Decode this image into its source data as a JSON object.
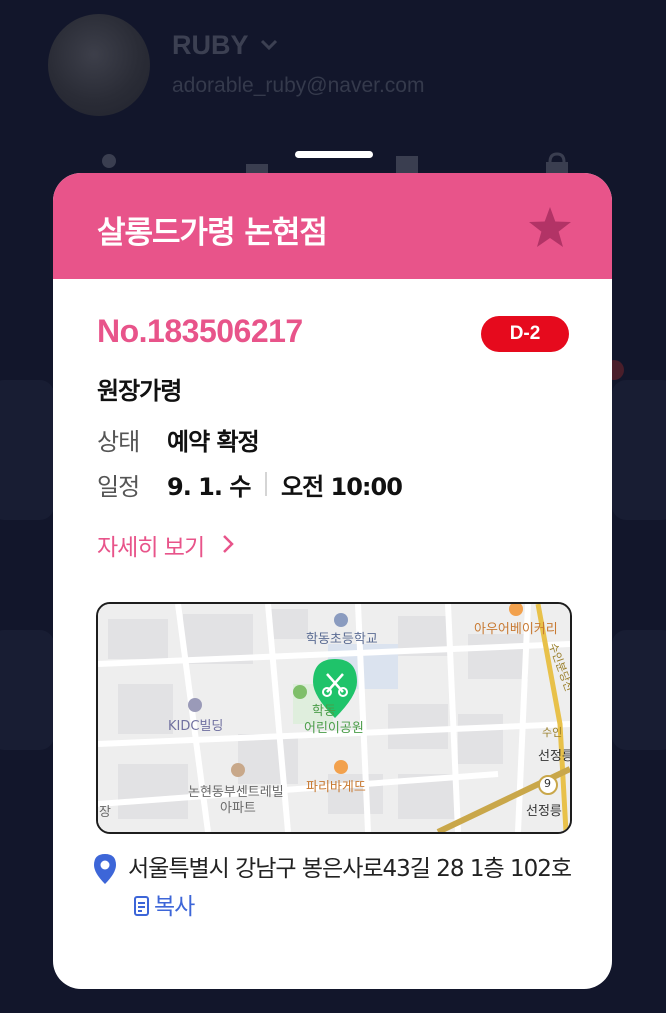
{
  "profile": {
    "name": "RUBY",
    "email": "adorable_ruby@naver.com"
  },
  "reservation": {
    "shop_name": "살롱드가령 논현점",
    "number": "No.183506217",
    "dday": "D-2",
    "service": "원장가령",
    "status_label": "상태",
    "status_value": "예약 확정",
    "schedule_label": "일정",
    "date": "9. 1. 수",
    "time": "오전 10:00",
    "detail_link": "자세히 보기"
  },
  "map": {
    "labels": {
      "school": "학동초등학교",
      "bakery_top": "아우어베이커리",
      "station_line": "수인분당선",
      "park_line1": "학동",
      "park_line2": "어린이공원",
      "kidc": "KIDC빌딩",
      "paris": "파리바게뜨",
      "apt_line1": "논현동부센트레빌",
      "apt_line2": "아파트",
      "station_right1": "선정릉",
      "station_right2": "선정릉",
      "left_edge": "장",
      "badge_9": "9",
      "badge_right": "수인"
    }
  },
  "address": {
    "text": "서울특별시 강남구 봉은사로43길 28 1층 102호",
    "copy_label": "복사"
  },
  "colors": {
    "accent": "#e8548a",
    "dday": "#e60a1d",
    "background": "#12162b",
    "pin": "#3d66d8",
    "map_marker": "#1fc36a"
  }
}
